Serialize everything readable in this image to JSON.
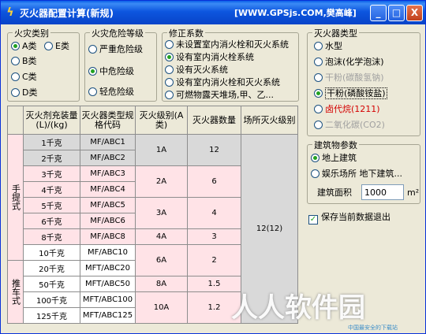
{
  "window": {
    "title": "灭火器配置计算(新规)",
    "site": "[WWW.GPSjs.COM,樊高峰]",
    "minimize": "_",
    "maximize": "□",
    "close": "X"
  },
  "fire_class": {
    "legend": "火灾类别",
    "options": [
      "A类",
      "E类",
      "B类",
      "C类",
      "D类"
    ],
    "selected": "A类"
  },
  "hazard": {
    "legend": "火灾危险等级",
    "options": [
      "严重危险级",
      "中危险级",
      "轻危险级"
    ],
    "selected": "中危险级"
  },
  "correction": {
    "legend": "修正系数",
    "options": [
      "未设置室内消火栓和灭火系统",
      "设有室内消火栓系统",
      "设有灭火系统",
      "设有室内消火栓和灭火系统",
      "可燃物露天堆场,甲、乙..."
    ],
    "selected": "设有室内消火栓系统"
  },
  "extinguisher_type": {
    "legend": "灭火器类型",
    "options": [
      "水型",
      "泡沫(化学泡沫)",
      "干粉(碳酸氢钠)",
      "干粉(磷酸铵盐)",
      "卤代烷(1211)",
      "二氧化碳(CO2)"
    ],
    "selected": "干粉(磷酸铵盐)"
  },
  "building": {
    "legend": "建筑物参数",
    "options": [
      "地上建筑",
      "娱乐场所 地下建筑..."
    ],
    "selected": "地上建筑",
    "area_label": "建筑面积",
    "area_value": "1000",
    "area_unit": "m²"
  },
  "save_checkbox": {
    "label": "保存当前数据退出",
    "checked": true
  },
  "table": {
    "headers": [
      "灭火剂充装量(L)/(kg)",
      "灭火器类型规格代码",
      "灭火级别(A类)",
      "灭火器数量",
      "场所灭火级别"
    ],
    "group_labels": [
      "手提式",
      "推车式"
    ],
    "rows": [
      {
        "amount": "1千克",
        "code": "MF/ABC1"
      },
      {
        "amount": "2千克",
        "code": "MF/ABC2"
      },
      {
        "amount": "3千克",
        "code": "MF/ABC3"
      },
      {
        "amount": "4千克",
        "code": "MF/ABC4"
      },
      {
        "amount": "5千克",
        "code": "MF/ABC5"
      },
      {
        "amount": "6千克",
        "code": "MF/ABC6"
      },
      {
        "amount": "8千克",
        "code": "MF/ABC8"
      },
      {
        "amount": "10千克",
        "code": "MF/ABC10"
      },
      {
        "amount": "20千克",
        "code": "MFT/ABC20"
      },
      {
        "amount": "50千克",
        "code": "MFT/ABC50"
      },
      {
        "amount": "100千克",
        "code": "MFT/ABC100"
      },
      {
        "amount": "125千克",
        "code": "MFT/ABC125"
      }
    ],
    "level_groups": [
      {
        "level": "1A",
        "count": "12"
      },
      {
        "level": "2A",
        "count": "6"
      },
      {
        "level": "3A",
        "count": "4"
      },
      {
        "level": "4A",
        "count": "3"
      },
      {
        "level": "6A",
        "count": "2"
      },
      {
        "level": "8A",
        "count": "1.5"
      },
      {
        "level": "10A",
        "count": "1.2"
      }
    ],
    "site_level": "12(12)"
  },
  "watermark": {
    "text": "人人软件园",
    "sub": "中国最安全的下载站"
  }
}
